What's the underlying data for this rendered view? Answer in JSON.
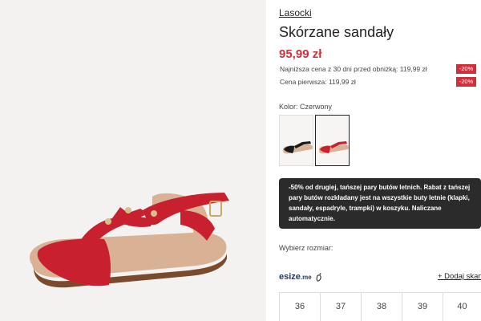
{
  "product": {
    "brand": "Lasocki",
    "title": "Skórzane sandały",
    "price": "95,99 zł",
    "price_history": [
      {
        "label": "Najniższa cena z 30 dni przed obniżką: 119,99 zł",
        "badge": "-20%"
      },
      {
        "label": "Cena pierwsza: 119,99 zł",
        "badge": "-20%"
      }
    ],
    "color_label": "Kolor: Czerwony",
    "swatches": [
      {
        "name": "black",
        "selected": false
      },
      {
        "name": "red",
        "selected": true
      }
    ],
    "promo_text": "-50% od drugiej, tańszej pary butów letnich. Rabat z tańszej pary butów rozkładany jest na wszystkie buty letnie (klapki, sandały, espadryle, trampki) w koszyku. Naliczane automatycznie.",
    "size_label": "Wybierz rozmiar:",
    "esize": {
      "brand": "esize",
      "suffix": ".me",
      "icon": "foot-icon",
      "add_scan": "+ Dodaj skan"
    },
    "sizes": [
      "36",
      "37",
      "38",
      "39",
      "40"
    ]
  },
  "colors": {
    "accent": "#d22e3a",
    "promo_bg": "#2b2b2b",
    "sandal_red": "#c8202f",
    "sole": "#d9b295"
  }
}
